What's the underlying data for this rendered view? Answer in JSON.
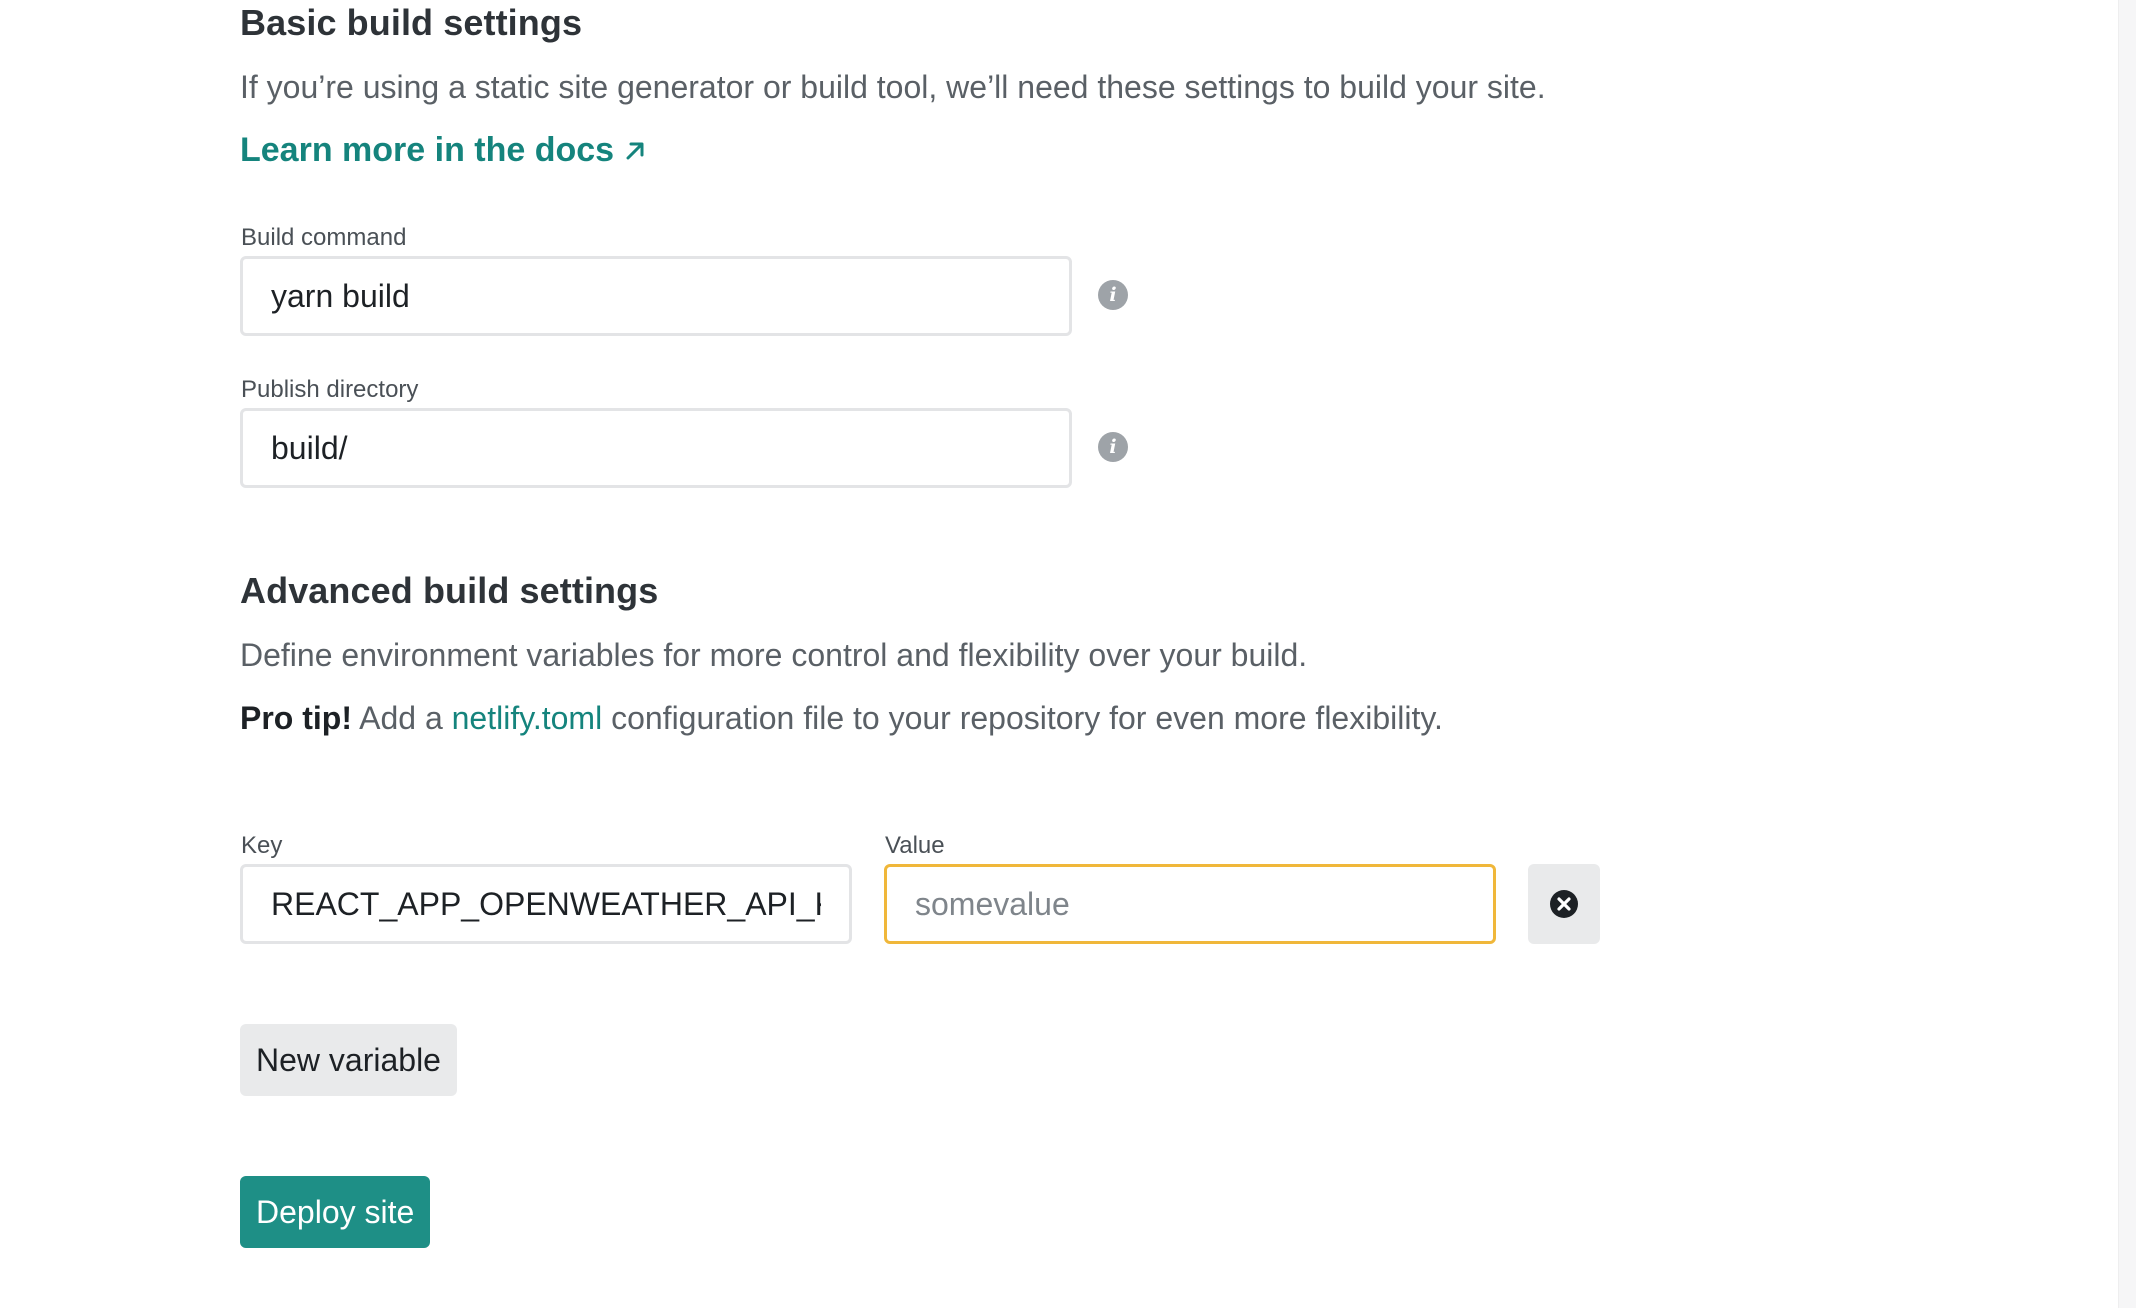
{
  "basic": {
    "title": "Basic build settings",
    "description": "If you’re using a static site generator or build tool, we’ll need these settings to build your site.",
    "docs_link": "Learn more in the docs"
  },
  "build_command": {
    "label": "Build command",
    "value": "yarn build",
    "info_icon": "info-icon"
  },
  "publish_directory": {
    "label": "Publish directory",
    "value": "build/",
    "info_icon": "info-icon"
  },
  "advanced": {
    "title": "Advanced build settings",
    "description": "Define environment variables for more control and flexibility over your build.",
    "pro_tip_label": "Pro tip!",
    "pro_tip_prefix": " Add a ",
    "pro_tip_link": "netlify.toml",
    "pro_tip_suffix": " configuration file to your repository for even more flexibility."
  },
  "env_var": {
    "key_label": "Key",
    "key_value": "REACT_APP_OPENWEATHER_API_KEY",
    "value_label": "Value",
    "value_placeholder": "somevalue",
    "value_value": "",
    "remove_icon": "close-circle-icon"
  },
  "buttons": {
    "new_variable": "New variable",
    "deploy": "Deploy site"
  },
  "colors": {
    "accent": "#15847d",
    "primary_button": "#1e8f86",
    "focus_border": "#f0b73a",
    "secondary_button": "#e9eaeb"
  }
}
